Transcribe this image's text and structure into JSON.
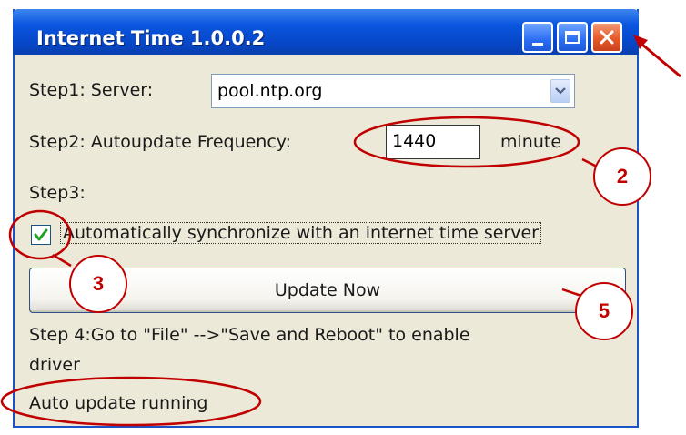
{
  "window": {
    "title": "Internet Time 1.0.0.2",
    "buttons": {
      "minimize": "minimize",
      "maximize": "maximize",
      "close": "close"
    }
  },
  "step1": {
    "label": "Step1: Server:",
    "server_value": "pool.ntp.org"
  },
  "step2": {
    "label": "Step2: Autoupdate Frequency:",
    "frequency_value": "1440",
    "unit": "minute"
  },
  "step3": {
    "label": "Step3:",
    "checkbox_checked": true,
    "checkbox_label": "Automatically synchronize with an internet time server"
  },
  "update_button": {
    "label": "Update Now"
  },
  "step4": {
    "line1": "Step 4:Go to \"File\" -->\"Save and Reboot\" to enable",
    "line2": "driver"
  },
  "status": {
    "text": "Auto update running"
  },
  "annotations": {
    "badge_2": "2",
    "badge_3": "3",
    "badge_5": "5",
    "color": "#c00000"
  },
  "colors": {
    "titlebar": "#0a55df",
    "window_bg": "#ece9d8",
    "close_button": "#e45a2a",
    "check": "#21a121"
  }
}
